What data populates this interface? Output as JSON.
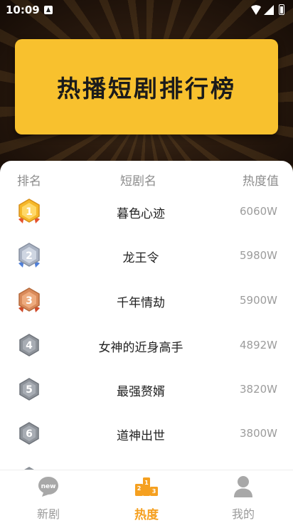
{
  "status_bar": {
    "time": "10:09"
  },
  "banner": {
    "title": "热播短剧排行榜"
  },
  "table": {
    "headers": {
      "rank": "排名",
      "name": "短剧名",
      "heat": "热度值"
    },
    "rows": [
      {
        "rank": "1",
        "title": "暮色心迹",
        "heat": "6060W",
        "medal": "gold"
      },
      {
        "rank": "2",
        "title": "龙王令",
        "heat": "5980W",
        "medal": "silver"
      },
      {
        "rank": "3",
        "title": "千年情劫",
        "heat": "5900W",
        "medal": "bronze"
      },
      {
        "rank": "4",
        "title": "女神的近身高手",
        "heat": "4892W",
        "medal": "plain"
      },
      {
        "rank": "5",
        "title": "最强赘婿",
        "heat": "3820W",
        "medal": "plain"
      },
      {
        "rank": "6",
        "title": "道神出世",
        "heat": "3800W",
        "medal": "plain"
      }
    ]
  },
  "nav": {
    "items": [
      {
        "label": "新剧",
        "icon": "new-icon",
        "badge": "new",
        "active": false
      },
      {
        "label": "热度",
        "icon": "podium-icon",
        "active": true
      },
      {
        "label": "我的",
        "icon": "user-icon",
        "active": false
      }
    ]
  },
  "colors": {
    "accent": "#f5a020",
    "banner": "#f8c12e",
    "gold": "#f5b82a",
    "silver": "#a9b2c2",
    "bronze": "#d98a5a",
    "plain": "#8e939a"
  }
}
